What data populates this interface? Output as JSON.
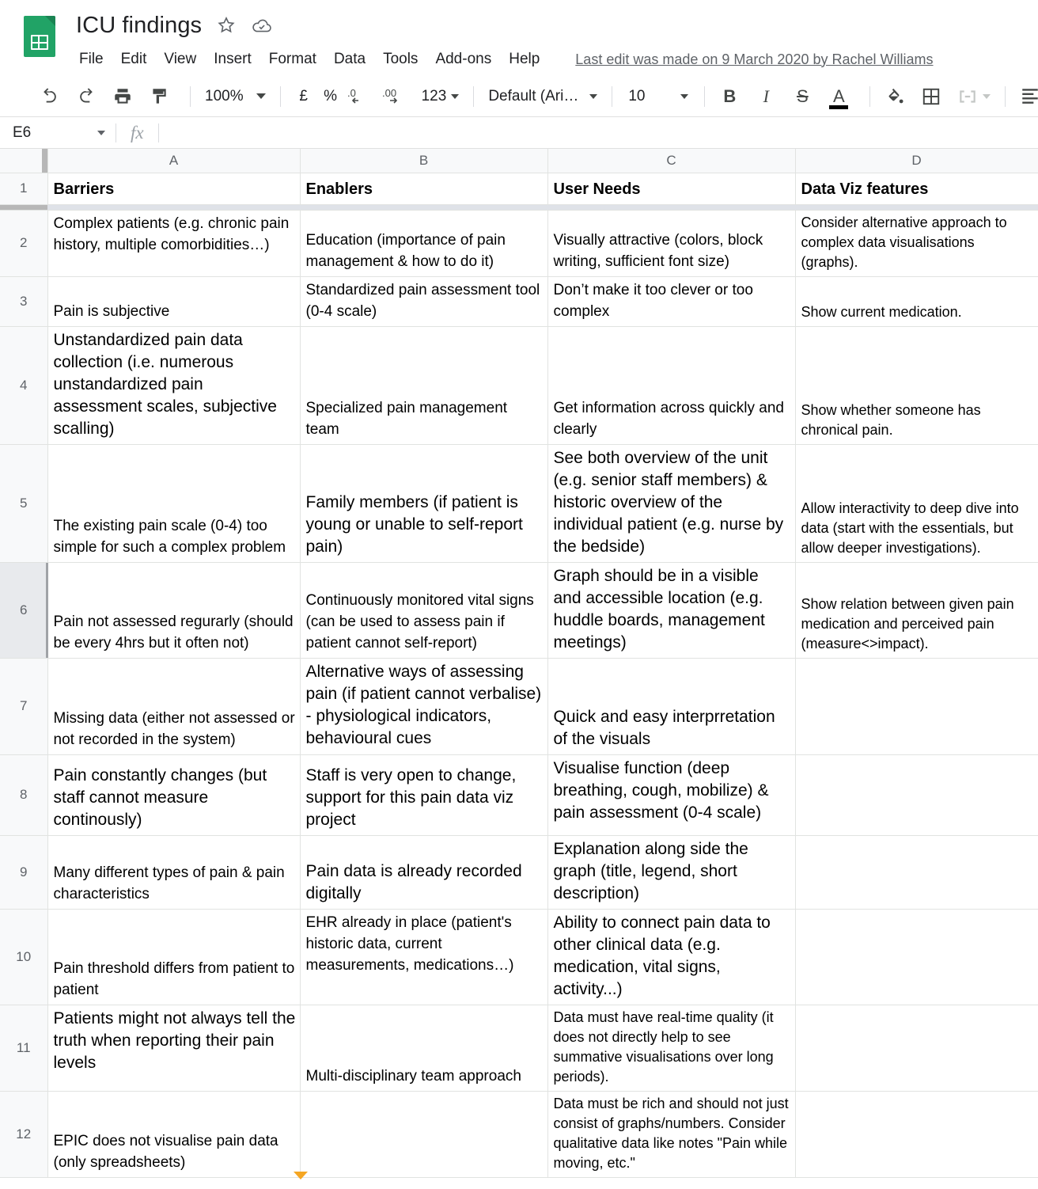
{
  "app": {
    "doc_title": "ICU findings",
    "icons": {
      "app_logo": "sheets-logo-icon",
      "star": "star-icon",
      "cloud": "cloud-saved-icon"
    },
    "menus": [
      "File",
      "Edit",
      "View",
      "Insert",
      "Format",
      "Data",
      "Tools",
      "Add-ons",
      "Help"
    ],
    "last_edit": "Last edit was made on 9 March 2020 by Rachel Williams"
  },
  "toolbar": {
    "undo": "undo-icon",
    "redo": "redo-icon",
    "print": "print-icon",
    "paint_format": "paint-format-icon",
    "zoom_value": "100%",
    "currency": "£",
    "percent": "%",
    "decrease_decimal": ".0",
    "increase_decimal": ".00",
    "more_formats": "123",
    "font_name": "Default (Ari…",
    "font_size": "10",
    "bold": "B",
    "italic": "I",
    "strikethrough": "S",
    "text_color": "A",
    "fill_color": "fill-color-icon",
    "borders": "borders-icon",
    "merge_cells": "merge-cells-icon",
    "horizontal_align": "align-icon"
  },
  "formula_bar": {
    "name_box": "E6",
    "fx_label": "fx",
    "formula_value": ""
  },
  "grid": {
    "column_headers": [
      "A",
      "B",
      "C",
      "D"
    ],
    "row_numbers": [
      "1",
      "2",
      "3",
      "4",
      "5",
      "6",
      "7",
      "8",
      "9",
      "10",
      "11",
      "12"
    ],
    "selected_cell": "E6",
    "selected_row": "6",
    "header_row": [
      "Barriers",
      "Enablers",
      "User Needs",
      "Data Viz features"
    ],
    "rows": [
      {
        "num": "2",
        "A": "Complex patients (e.g. chronic pain history, multiple comorbidities…)",
        "B": "Education (importance of pain management & how to do it)",
        "C": "Visually attractive (colors, block writing, sufficient font size)",
        "D": "Consider alternative approach to complex data visualisations (graphs)."
      },
      {
        "num": "3",
        "A": "Pain is subjective",
        "B": "Standardized pain assessment tool (0-4 scale)",
        "C": "Don’t make it too clever or too complex",
        "D": "Show current medication."
      },
      {
        "num": "4",
        "A": "Unstandardized pain data collection (i.e. numerous unstandardized pain assessment scales, subjective scalling)",
        "B": "Specialized pain management team",
        "C": "Get information across quickly and clearly",
        "D": "Show whether someone has chronical pain."
      },
      {
        "num": "5",
        "A": "The existing pain scale (0-4) too simple for such a complex problem",
        "B": "Family members (if patient is young or unable to self-report pain)",
        "C": "See both overview of the unit (e.g. senior staff members) & historic overview of the individual patient (e.g. nurse by the bedside)",
        "D": "Allow interactivity to deep dive into data (start with the essentials, but allow deeper investigations)."
      },
      {
        "num": "6",
        "A": "Pain not assessed regurarly (should be every 4hrs but it often not)",
        "B": "Continuously monitored vital signs (can be used to assess pain if patient cannot self-report)",
        "C": "Graph should be in a visible and accessible location (e.g. huddle boards, management meetings)",
        "D": "Show relation between given pain medication and perceived pain (measure<>impact)."
      },
      {
        "num": "7",
        "A": "Missing data (either not assessed or not recorded in the system)",
        "B": "Alternative ways of assessing pain (if patient cannot verbalise) - physiological indicators, behavioural cues",
        "C": "Quick and easy interprretation of the visuals",
        "D": ""
      },
      {
        "num": "8",
        "A": "Pain constantly changes (but staff cannot measure continously)",
        "B": "Staff is very open to change, support for this pain data viz project",
        "C": "Visualise function (deep breathing, cough, mobilize) & pain assessment (0-4 scale)",
        "D": ""
      },
      {
        "num": "9",
        "A": "Many different types of pain & pain characteristics",
        "B": "Pain data is already recorded digitally",
        "C": "Explanation along side the graph (title, legend, short description)",
        "D": ""
      },
      {
        "num": "10",
        "A": "Pain threshold differs from patient to patient",
        "B": "EHR already in place (patient's historic data, current measurements, medications…)",
        "C": "Ability to connect pain data to other clinical data (e.g. medication, vital signs, activity...)",
        "D": ""
      },
      {
        "num": "11",
        "A": "Patients might not always tell the truth when reporting their pain levels",
        "B": "Multi-disciplinary team approach",
        "C": "Data must have real-time quality (it does not directly help to see summative visualisations over long periods).",
        "D": ""
      },
      {
        "num": "12",
        "A": "EPIC does not visualise pain data (only spreadsheets)",
        "B": "",
        "C": "Data must be rich and should not just consist of graphs/numbers. Consider qualitative data like notes \"Pain while moving, etc.\"",
        "D": ""
      }
    ]
  },
  "colors": {
    "brand_green": "#21a366",
    "grid_line": "#e1e3e1",
    "header_bg": "#f8f9fa",
    "selected_row_bg": "#e8eaed",
    "marker_orange": "#f5a623"
  }
}
